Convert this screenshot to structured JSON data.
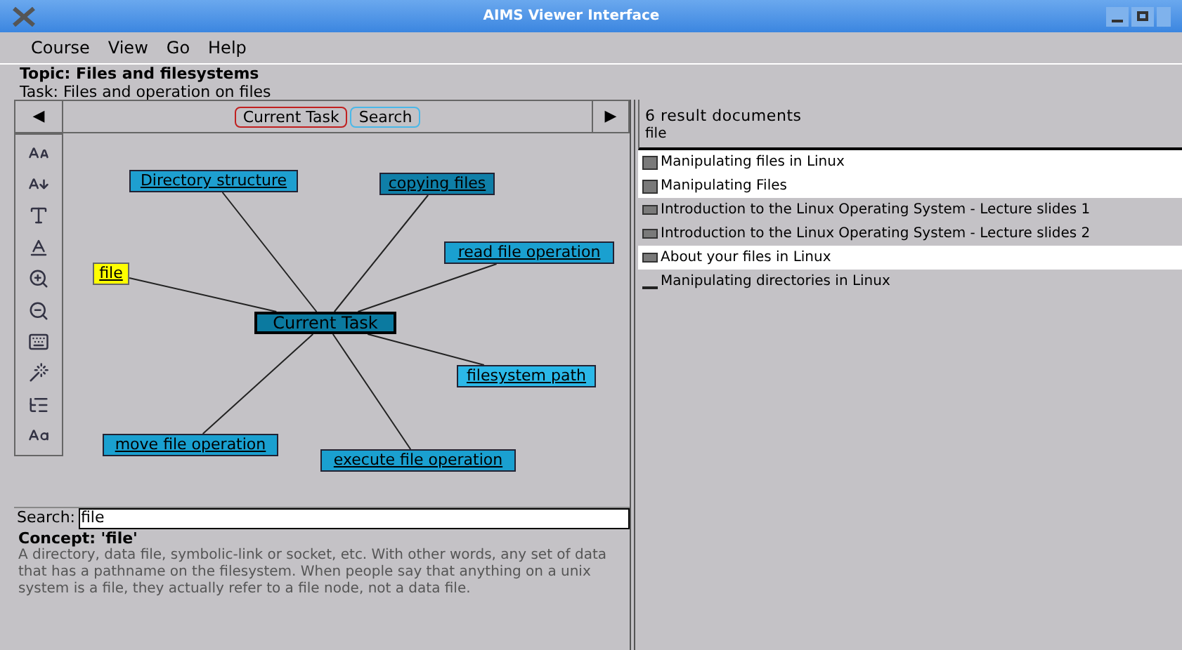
{
  "window": {
    "title": "AIMS Viewer Interface"
  },
  "menu": [
    "Course",
    "View",
    "Go",
    "Help"
  ],
  "topic": {
    "title": "Topic: Files and filesystems",
    "task": "Task: Files and operation on files"
  },
  "nav": {
    "prev": "◀",
    "next": "▶",
    "tabs": [
      {
        "label": "Current Task",
        "selected": true
      },
      {
        "label": "Search",
        "selected": false
      }
    ]
  },
  "graph": {
    "center": {
      "label": "Current Task",
      "color": "#0b7aa0"
    },
    "nodes": [
      {
        "label": "Directory structure",
        "color": "#1e9fd0",
        "selected": false
      },
      {
        "label": "copying files",
        "color": "#0f7fa8",
        "selected": false
      },
      {
        "label": "read file operation",
        "color": "#1aa0d0",
        "selected": false
      },
      {
        "label": "file",
        "color": "#ffff00",
        "selected": true
      },
      {
        "label": "filesystem path",
        "color": "#2bb8e8",
        "selected": false
      },
      {
        "label": "move file operation",
        "color": "#1aa0d0",
        "selected": false
      },
      {
        "label": "execute file operation",
        "color": "#1aa0d0",
        "selected": false
      }
    ]
  },
  "search": {
    "label": "Search:",
    "value": "file"
  },
  "concept": {
    "title": "Concept: 'file'",
    "text": "A directory, data file, symbolic-link or socket, etc. With other words, any set of data that has a pathname on the filesystem. When people say that anything on a unix system is a file, they actually refer to a file node, not a data file."
  },
  "results": {
    "count": "6 result documents",
    "query": "file",
    "items": [
      {
        "title": "Manipulating files in Linux",
        "highlighted": true,
        "kind": "square"
      },
      {
        "title": "Manipulating Files",
        "highlighted": true,
        "kind": "square"
      },
      {
        "title": "Introduction to the Linux Operating System - Lecture slides 1",
        "highlighted": false,
        "kind": "flat"
      },
      {
        "title": "Introduction to the Linux Operating System - Lecture slides 2",
        "highlighted": false,
        "kind": "flat"
      },
      {
        "title": "About your files in Linux",
        "highlighted": true,
        "kind": "flat"
      },
      {
        "title": "Manipulating directories in Linux",
        "highlighted": false,
        "kind": "line"
      }
    ]
  }
}
